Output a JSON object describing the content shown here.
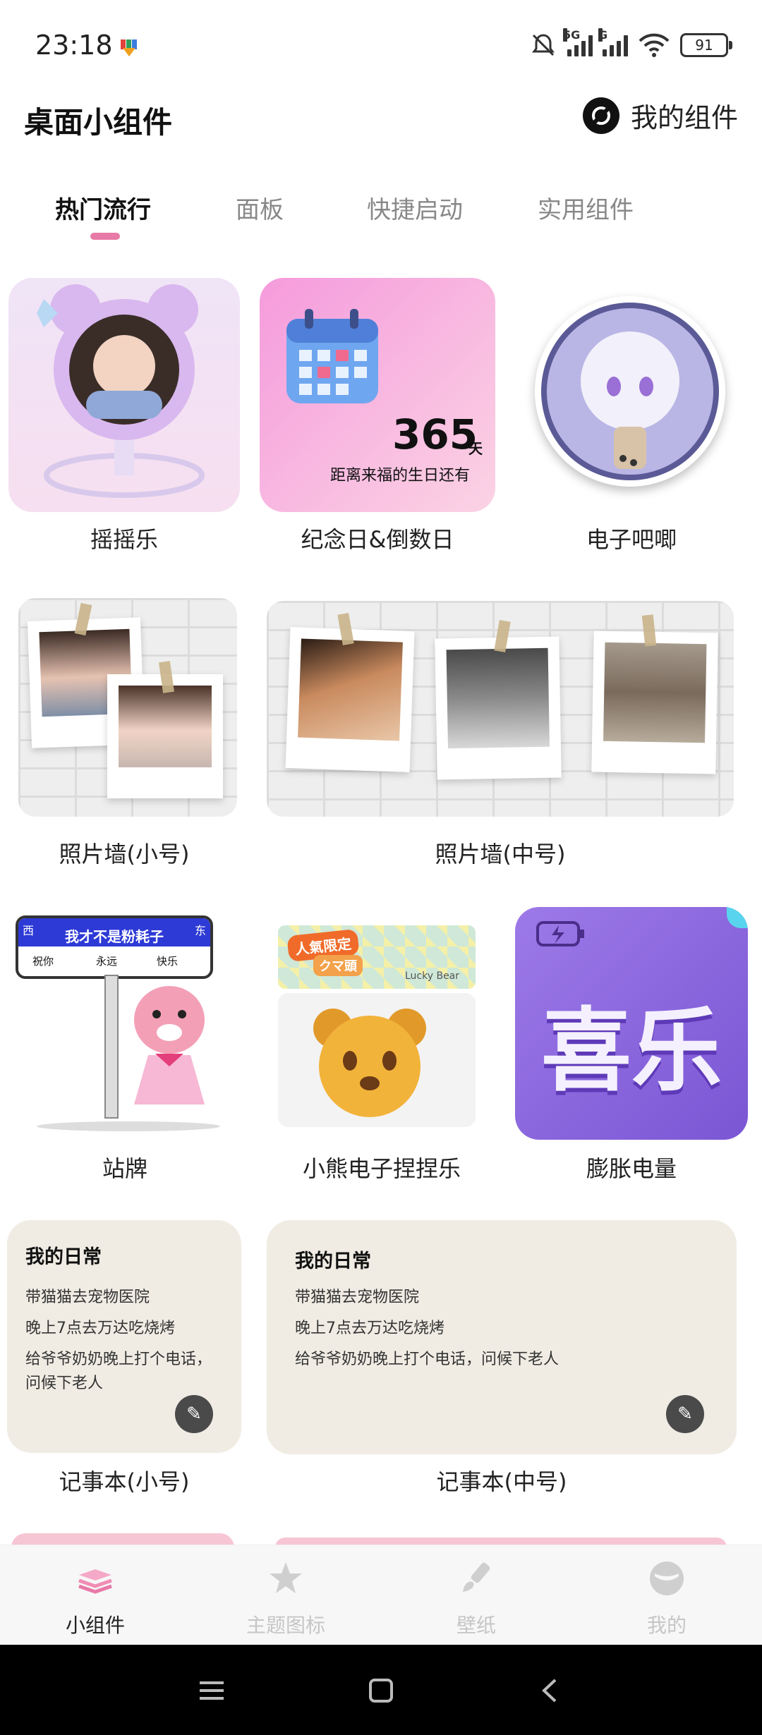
{
  "status_bar": {
    "time": "23:18",
    "signal1": "5G",
    "signal2": "G",
    "battery": "91"
  },
  "header": {
    "title": "桌面小组件",
    "my_widgets": "我的组件"
  },
  "tabs": [
    "热门流行",
    "面板",
    "快捷启动",
    "实用组件"
  ],
  "widgets": {
    "yaoyaole": "摇摇乐",
    "anniversary": {
      "label": "纪念日&倒数日",
      "days": "365",
      "unit": "天",
      "caption": "距离来福的生日还有"
    },
    "badge": "电子吧唧",
    "photo_wall_small": "照片墙(小号)",
    "photo_wall_medium": "照片墙(中号)",
    "station_sign": {
      "label": "站牌",
      "west": "西",
      "east": "东",
      "name": "我才不是粉耗子",
      "words": [
        "祝你",
        "永远",
        "快乐"
      ]
    },
    "bear_squeeze": {
      "label": "小熊电子捏捏乐",
      "tag": "人氣限定",
      "tag2": "クマ頭",
      "brand": "Lucky Bear"
    },
    "battery_widget": {
      "label": "膨胀电量",
      "text": "喜乐"
    },
    "notebook_small": {
      "label": "记事本(小号)",
      "title": "我的日常",
      "lines": [
        "带猫猫去宠物医院",
        "晚上7点去万达吃烧烤",
        "给爷爷奶奶晚上打个电话，",
        "问候下老人"
      ]
    },
    "notebook_medium": {
      "label": "记事本(中号)",
      "title": "我的日常",
      "lines": [
        "带猫猫去宠物医院",
        "晚上7点去万达吃烧烤",
        "给爷爷奶奶晚上打个电话，问候下老人"
      ]
    }
  },
  "bottom_nav": [
    "小组件",
    "主题图标",
    "壁纸",
    "我的"
  ],
  "colors": {
    "accent": "#e77aa6",
    "purple": "#8b6fd6"
  }
}
